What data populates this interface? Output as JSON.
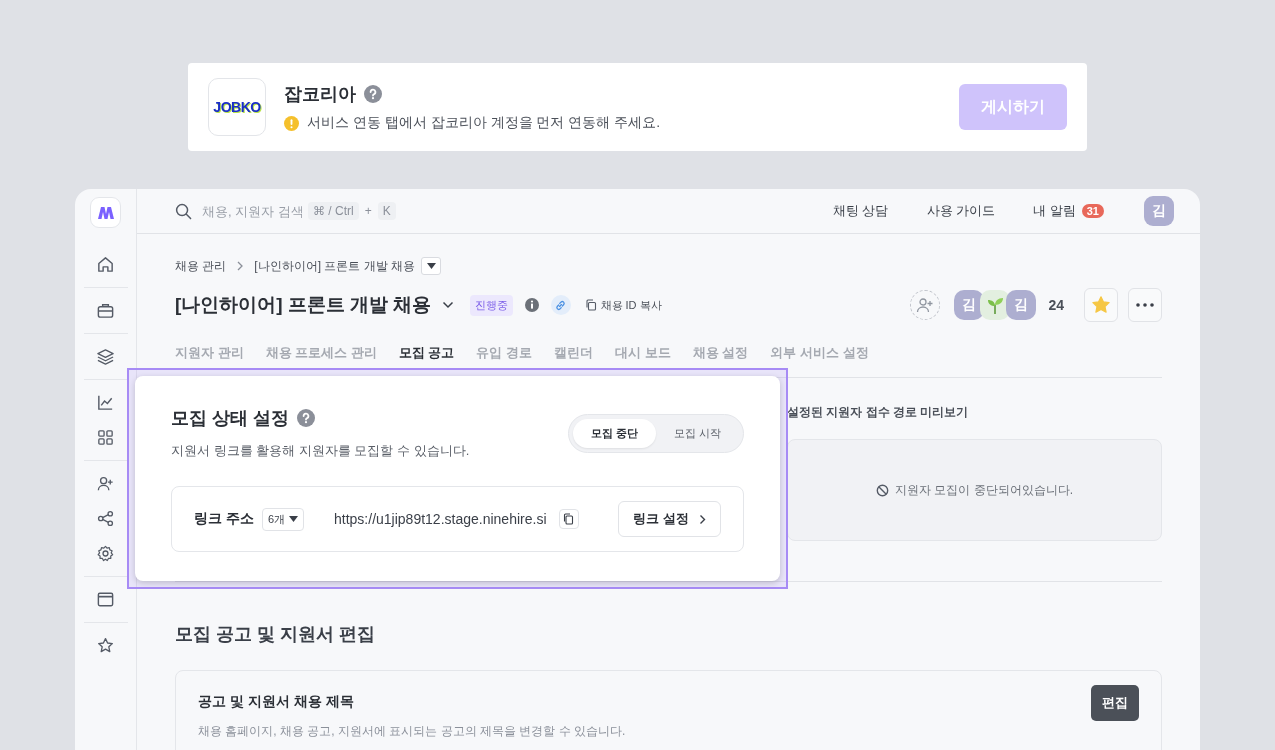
{
  "integration": {
    "logo": "JOBKO",
    "name": "잡코리아",
    "notice": "서비스 연동 탭에서 잡코리아 계정을 먼저 연동해 주세요.",
    "button": {
      "label": "게시하기",
      "disabled": true
    }
  },
  "topbar": {
    "search_placeholder": "채용, 지원자 검색",
    "shortcut_keys": [
      "⌘ / Ctrl",
      "K"
    ],
    "shortcut_join": "+",
    "links": [
      "채팅 상담",
      "사용 가이드"
    ],
    "notifications": {
      "label": "내 알림",
      "count": "31"
    },
    "avatar": "김"
  },
  "breadcrumb": [
    "채용 관리",
    "[나인하이어] 프론트 개발 채용"
  ],
  "job": {
    "title": "[나인하이어] 프론트 개발 채용",
    "status": "진행중",
    "copy_id": "채용 ID 복사",
    "members": [
      {
        "kind": "initial",
        "initial": "김"
      },
      {
        "kind": "sprout"
      },
      {
        "kind": "initial",
        "initial": "김"
      }
    ],
    "member_count": "24",
    "starred": true
  },
  "tabs": [
    {
      "label": "지원자 관리",
      "selected": false
    },
    {
      "label": "채용 프로세스 관리",
      "selected": false
    },
    {
      "label": "모집 공고",
      "selected": true
    },
    {
      "label": "유입 경로",
      "selected": false
    },
    {
      "label": "캘린더",
      "selected": false
    },
    {
      "label": "대시 보드",
      "selected": false
    },
    {
      "label": "채용 설정",
      "selected": false
    },
    {
      "label": "외부 서비스 설정",
      "selected": false
    }
  ],
  "recruit_status": {
    "title": "모집 상태 설정",
    "description": "지원서 링크를 활용해 지원자를 모집할 수 있습니다.",
    "toggle": [
      {
        "label": "모집 중단",
        "selected": true
      },
      {
        "label": "모집 시작",
        "selected": false
      }
    ],
    "link_label": "링크 주소",
    "link_count": "6개",
    "url": "https://u1jip89t12.stage.ninehire.si",
    "link_settings": "링크 설정"
  },
  "preview": {
    "title": "설정된 지원자 접수 경로 미리보기",
    "message": "지원자 모집이 중단되어있습니다."
  },
  "edit_section": {
    "title": "모집 공고 및 지원서 편집",
    "cards": [
      {
        "title": "공고 및 지원서 채용 제목",
        "description": "채용 홈페이지, 채용 공고, 지원서에 표시되는 공고의 제목을 변경할 수 있습니다.",
        "button": "편집"
      }
    ]
  }
}
